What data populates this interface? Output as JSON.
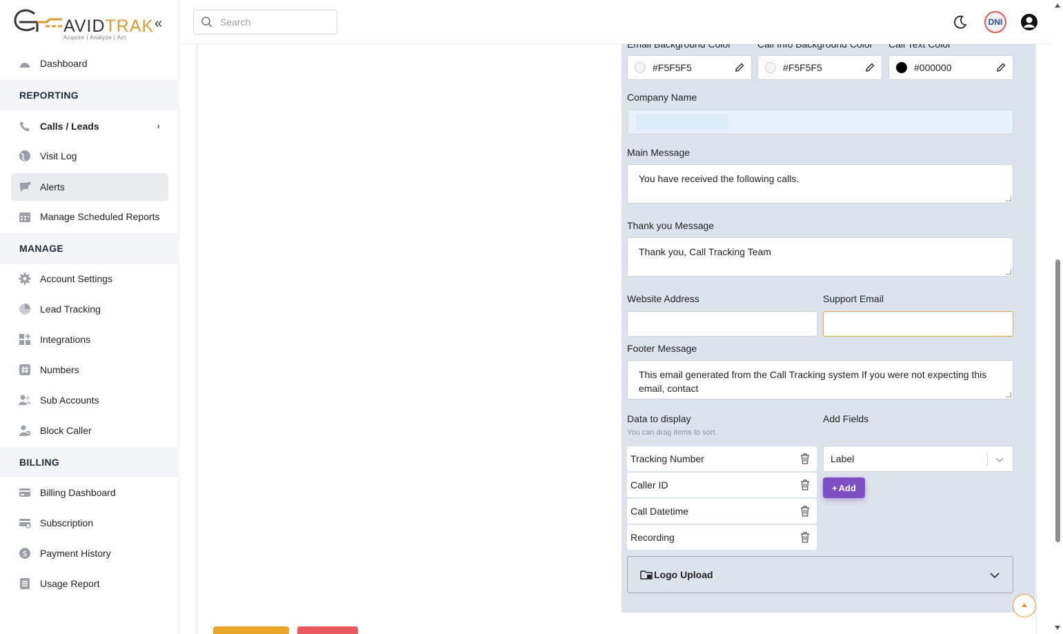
{
  "brand": {
    "name_a": "AVID",
    "name_b": "TRAK",
    "tagline": "Acquire  |  Analyze  |  Act",
    "collapse_icon": "double-chevron-left-icon"
  },
  "search": {
    "placeholder": "Search"
  },
  "header": {
    "dni_label": "DNI"
  },
  "sidebar": {
    "top": {
      "label": "Dashboard"
    },
    "sections": [
      {
        "title": "REPORTING",
        "items": [
          "Calls / Leads",
          "Visit Log",
          "Alerts",
          "Manage Scheduled Reports"
        ]
      },
      {
        "title": "MANAGE",
        "items": [
          "Account Settings",
          "Lead Tracking",
          "Integrations",
          "Numbers",
          "Sub Accounts",
          "Block Caller"
        ]
      },
      {
        "title": "BILLING",
        "items": [
          "Billing Dashboard",
          "Subscription",
          "Payment History",
          "Usage Report"
        ]
      }
    ],
    "active_item": "Alerts"
  },
  "form": {
    "colors": [
      {
        "label": "Email Background Color",
        "value": "#F5F5F5",
        "swatch": "#F5F5F5"
      },
      {
        "label": "Call Info Background Color",
        "value": "#F5F5F5",
        "swatch": "#F5F5F5"
      },
      {
        "label": "Call Text Color",
        "value": "#000000",
        "swatch": "#000000"
      }
    ],
    "company_name_label": "Company Name",
    "main_message_label": "Main Message",
    "main_message": "You have received the following calls.",
    "thank_you_label": "Thank you Message",
    "thank_you": "Thank you, Call Tracking Team",
    "website_label": "Website Address",
    "support_email_label": "Support Email",
    "footer_label": "Footer Message",
    "footer": "This email generated from the Call Tracking system If you were not expecting this email, contact",
    "data_display_label": "Data to display",
    "data_display_hint": "You can drag items to sort.",
    "fields": [
      "Tracking Number",
      "Caller ID",
      "Call Datetime",
      "Recording"
    ],
    "add_fields_label": "Add Fields",
    "add_fields_selected": "Label",
    "add_button": "Add",
    "logo_upload": "Logo Upload"
  }
}
